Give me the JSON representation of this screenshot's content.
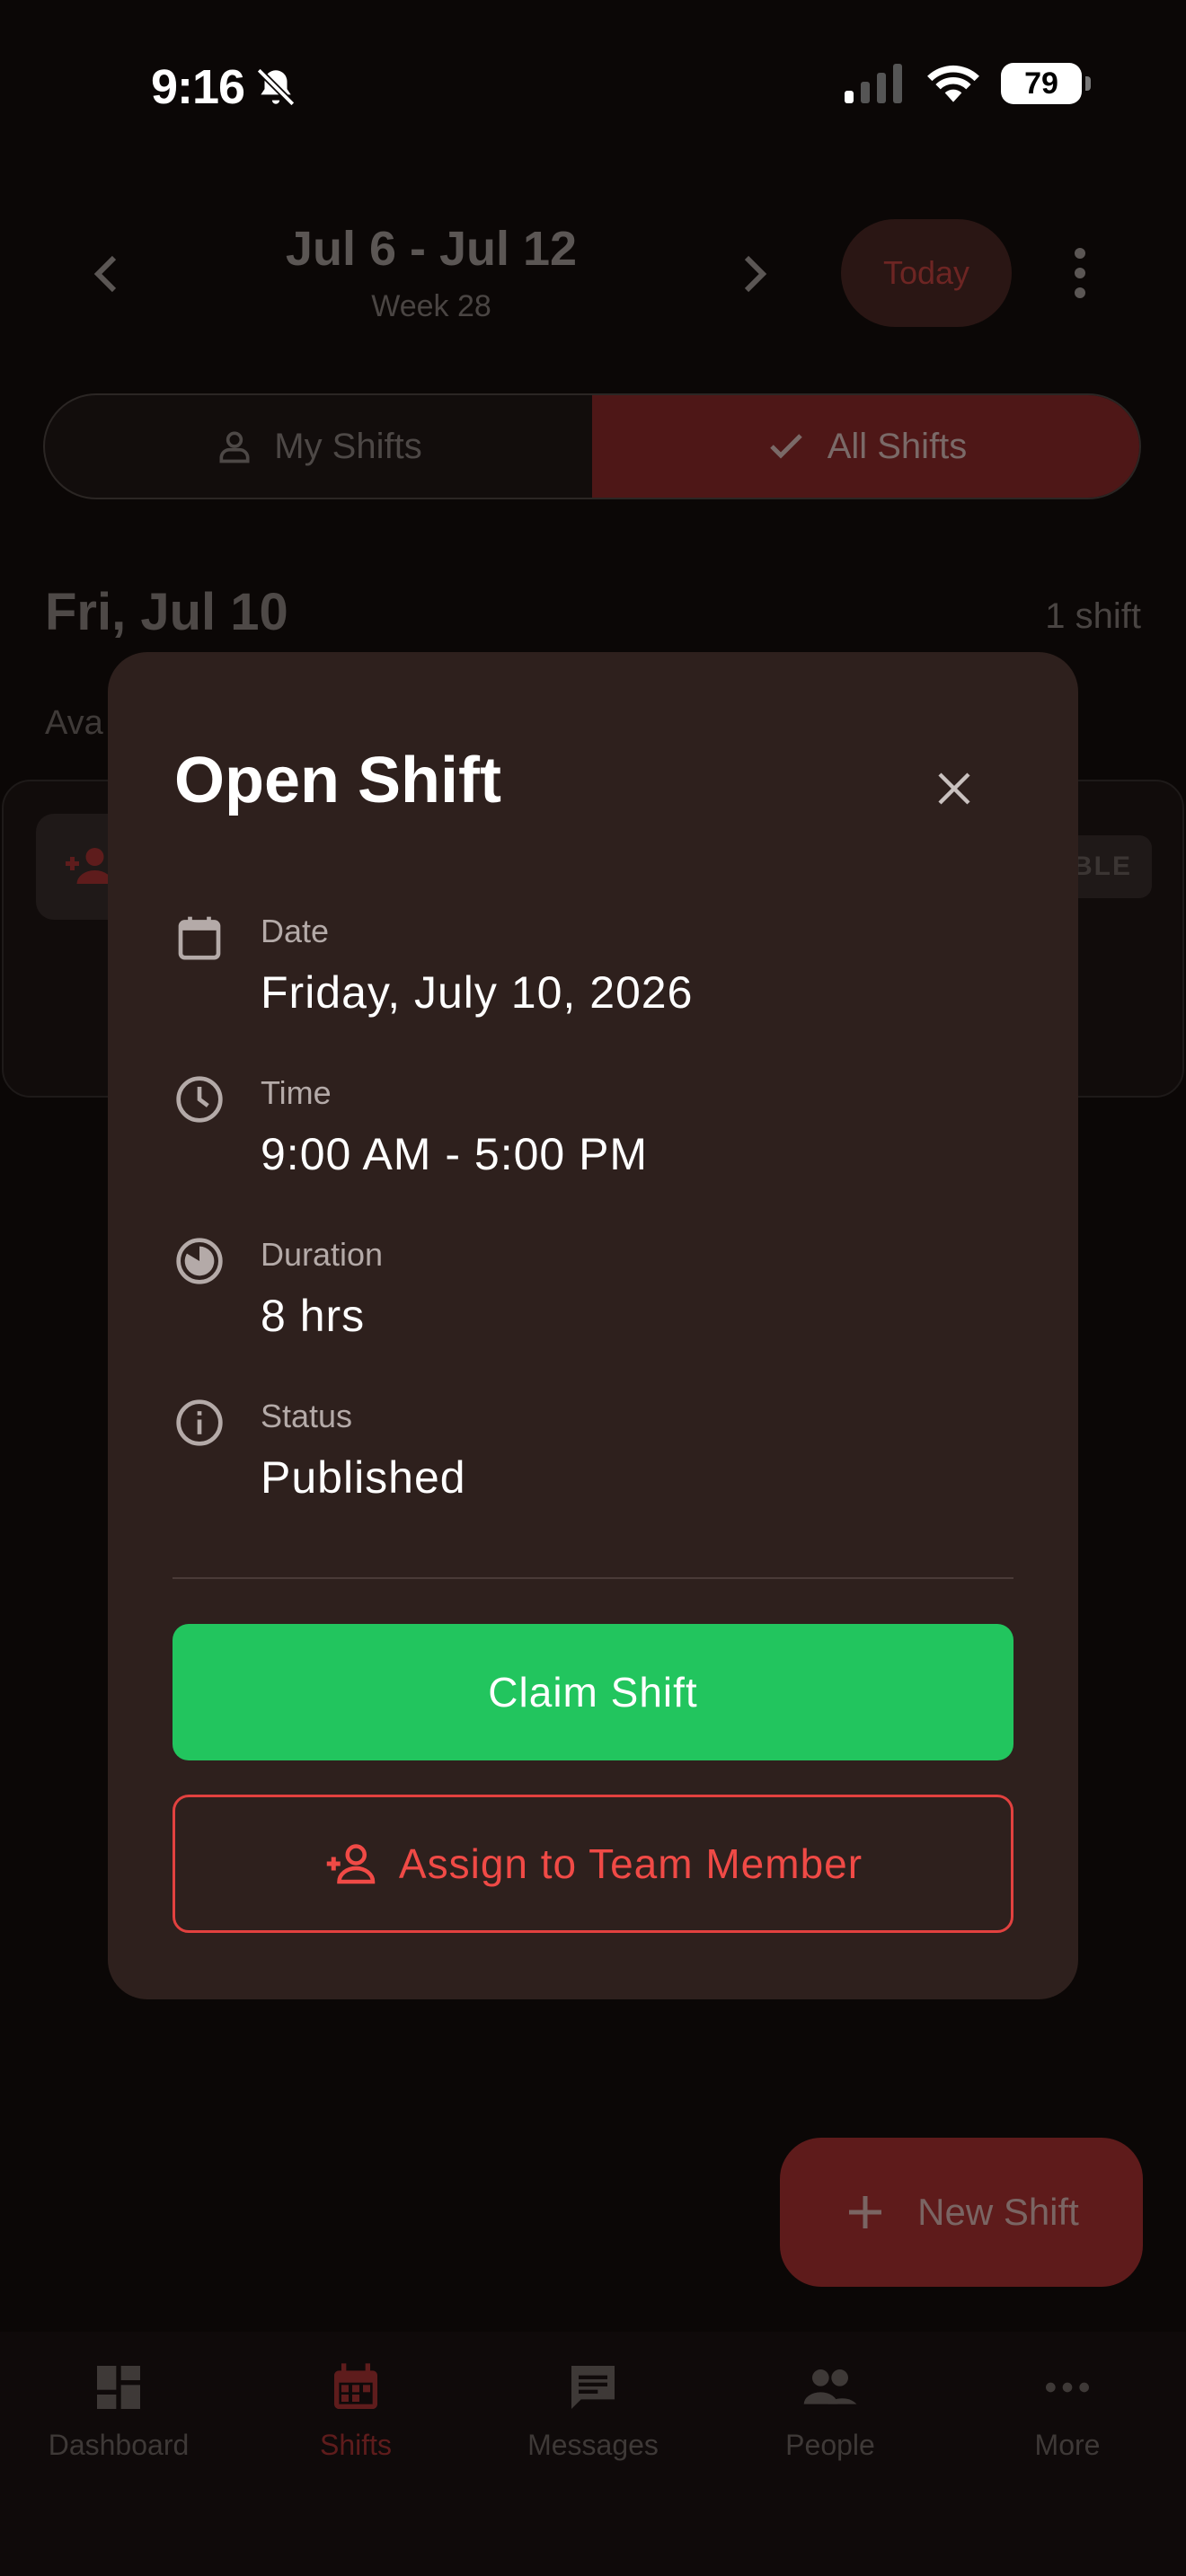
{
  "status_bar": {
    "time": "9:16",
    "battery": "79"
  },
  "week_nav": {
    "title": "Jul 6 - Jul 12",
    "subtitle": "Week 28",
    "today_label": "Today"
  },
  "segments": [
    {
      "label": "My Shifts",
      "icon": "person-icon",
      "active": false
    },
    {
      "label": "All Shifts",
      "icon": "check-icon",
      "active": true
    }
  ],
  "day": {
    "title": "Fri, Jul 10",
    "count": "1 shift",
    "section_label": "Ava",
    "badge": "BLE"
  },
  "fab": {
    "label": "New Shift"
  },
  "tabs": [
    {
      "label": "Dashboard",
      "icon": "dashboard-icon",
      "active": false
    },
    {
      "label": "Shifts",
      "icon": "calendar-icon",
      "active": true
    },
    {
      "label": "Messages",
      "icon": "message-icon",
      "active": false
    },
    {
      "label": "People",
      "icon": "people-icon",
      "active": false
    },
    {
      "label": "More",
      "icon": "more-icon",
      "active": false
    }
  ],
  "modal": {
    "title": "Open Shift",
    "details": [
      {
        "label": "Date",
        "value": "Friday, July 10, 2026",
        "icon": "calendar-icon"
      },
      {
        "label": "Time",
        "value": "9:00 AM - 5:00 PM",
        "icon": "clock-icon"
      },
      {
        "label": "Duration",
        "value": "8 hrs",
        "icon": "pie-timer-icon"
      },
      {
        "label": "Status",
        "value": "Published",
        "icon": "info-icon"
      }
    ],
    "claim_label": "Claim Shift",
    "assign_label": "Assign to Team Member"
  },
  "colors": {
    "accent": "#e2413f",
    "claim": "#22c55e",
    "modal_bg": "#2e201d"
  }
}
